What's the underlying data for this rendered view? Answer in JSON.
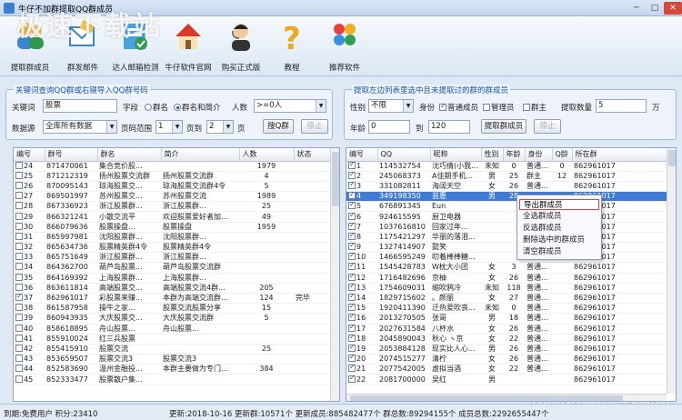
{
  "window": {
    "title": "牛仔不加群提取QQ群成员",
    "min": "─",
    "max": "□",
    "close": "✕"
  },
  "toolbar": [
    {
      "label": "提取群成员",
      "icon": "people-icon"
    },
    {
      "label": "群发邮件",
      "icon": "mail-icon"
    },
    {
      "label": "达人邮箱检测",
      "icon": "mail-check-icon"
    },
    {
      "label": "牛仔软件官网",
      "icon": "home-icon"
    },
    {
      "label": "购买正式版",
      "icon": "support-icon"
    },
    {
      "label": "教程",
      "icon": "help-icon"
    },
    {
      "label": "推荐软件",
      "icon": "apps-icon"
    }
  ],
  "watermark": "极速下载站",
  "left": {
    "panel_title": "关键词查询QQ群或右键导入QQ群号码",
    "keyword_label": "关键词",
    "keyword_value": "股票",
    "field_label": "字段",
    "field_options": [
      "群名",
      "群名和简介"
    ],
    "field_selected": "群名和简介",
    "people_label": "人数",
    "people_value": ">=0人",
    "source_label": "数据源",
    "source_value": "全库所有数据",
    "page_range_label": "页码范围",
    "page_from": "1",
    "page_to_label": "页到",
    "page_to": "2",
    "page_unit": "页",
    "search_btn": "搜Q群",
    "stop_btn": "停止",
    "columns": [
      "编号",
      "群号",
      "群名",
      "简介",
      "人数",
      "状态"
    ],
    "rows": [
      [
        "24",
        "871470061",
        "集合竞价股...",
        "",
        "1979",
        ""
      ],
      [
        "25",
        "871212319",
        "扬州股票交流群",
        "扬州股票交流群",
        "4",
        ""
      ],
      [
        "26",
        "870095143",
        "琼海股票交...",
        "琼海股票交流群4令",
        "5",
        ""
      ],
      [
        "27",
        "869501997",
        "苏州股票交...",
        "苏州股票交流",
        "1989",
        ""
      ],
      [
        "28",
        "867336923",
        "浙江股票群...",
        "浙江股票群...",
        "25",
        ""
      ],
      [
        "29",
        "866321241",
        "小散交流平",
        "欢迎股票爱好者加...",
        "49",
        ""
      ],
      [
        "30",
        "866079636",
        "股票操盘...",
        "股票操盘",
        "1959",
        ""
      ],
      [
        "31",
        "865997981",
        "沈阳股票群...",
        "沈阳股票群...",
        "",
        ""
      ],
      [
        "32",
        "865634736",
        "股票精英群4令",
        "股票精英群4令",
        "",
        ""
      ],
      [
        "33",
        "865751649",
        "浙江股票群...",
        "浙江股票群...",
        "",
        ""
      ],
      [
        "34",
        "864362700",
        "葫芦岛股票...",
        "葫芦岛股票交流群",
        "",
        ""
      ],
      [
        "35",
        "864169392",
        "上海股票群...",
        "上海股票群...",
        "",
        ""
      ],
      [
        "36",
        "863611814",
        "高端股票交...",
        "高端股票交流4群...",
        "205",
        ""
      ],
      [
        "37",
        "862961017",
        "彩股票来赚...",
        "本群为高端交流群...",
        "124",
        "完毕"
      ],
      [
        "38",
        "861587958",
        "操牛之家...",
        "股票交流股票分享",
        "15",
        ""
      ],
      [
        "39",
        "860943935",
        "大庆股票交...",
        "大庆股票交流群",
        "5",
        ""
      ],
      [
        "40",
        "858618895",
        "舟山股票...",
        "舟山股票...",
        "",
        ""
      ],
      [
        "41",
        "855910024",
        "红三兵股票",
        "",
        "",
        ""
      ],
      [
        "42",
        "855415910",
        "股票交流",
        "",
        "25",
        ""
      ],
      [
        "43",
        "853659507",
        "股票交流3",
        "股票交流3",
        "",
        ""
      ],
      [
        "44",
        "852583690",
        "温州金融投...",
        "本群主要做为专门...",
        "384",
        ""
      ],
      [
        "45",
        "852333477",
        "股票散户集...",
        "",
        "",
        ""
      ]
    ]
  },
  "right": {
    "panel_title": "提取左边列表里选中且未提取过的群的群成员",
    "gender_label": "性别",
    "gender_value": "不限",
    "identity_label": "身份",
    "opt_normal": "普通成员",
    "opt_admin": "管理员",
    "opt_owner": "群主",
    "count_label": "提取数量",
    "count_value": "5",
    "count_unit": "万",
    "age_label": "年龄",
    "age_from": "0",
    "age_to_label": "到",
    "age_to": "120",
    "extract_btn": "提取群成员",
    "stop_btn": "停止",
    "columns": [
      "编号",
      "QQ",
      "昵称",
      "性别",
      "年龄",
      "身份",
      "Q龄",
      "所在群"
    ],
    "rows": [
      [
        "1",
        "114532754",
        "沈巧倩(小我...",
        "未知",
        "0",
        "普通...",
        "0",
        "862961017"
      ],
      [
        "2",
        "245068373",
        "A佳期手机...",
        "男",
        "25",
        "群主",
        "12",
        "862961017"
      ],
      [
        "3",
        "331082811",
        "海阔天空",
        "女",
        "26",
        "普通...",
        "",
        "862961017"
      ],
      [
        "4",
        "349198350",
        "芸惠",
        "男",
        "28",
        "",
        "",
        "862961017"
      ],
      [
        "5",
        "676891345",
        "Eun",
        "",
        "",
        "",
        "",
        "862961017"
      ],
      [
        "6",
        "924615595",
        "厨卫电器",
        "",
        "",
        "",
        "",
        "862961017"
      ],
      [
        "7",
        "1037616810",
        "回家过年...",
        "",
        "",
        "",
        "",
        "862961017"
      ],
      [
        "8",
        "1175421297",
        "华丽的落泪...",
        "",
        "",
        "",
        "",
        "862961017"
      ],
      [
        "9",
        "1327414907",
        "懿笑",
        "",
        "",
        "",
        "",
        "862961017"
      ],
      [
        "10",
        "1466595249",
        "叨着棒棒糖...",
        "",
        "",
        "",
        "",
        "862961017"
      ],
      [
        "11",
        "1545428783",
        "W枕大小团",
        "女",
        "3",
        "普通...",
        "",
        "862961017"
      ],
      [
        "12",
        "1716482696",
        "京柚",
        "女",
        "26",
        "普通...",
        "",
        "862961017"
      ],
      [
        "13",
        "1754609031",
        "缩吹鸦冷",
        "未知",
        "118",
        "普通...",
        "",
        "862961017"
      ],
      [
        "14",
        "1829715602",
        "。颜丽",
        "女",
        "27",
        "普通...",
        "",
        "862961017"
      ],
      [
        "15",
        "1920411390",
        "迁热爱吹丧...",
        "未知",
        "0",
        "普通...",
        "",
        "862961017"
      ],
      [
        "16",
        "2013270505",
        "张哥",
        "男",
        "18",
        "普通...",
        "",
        "862961017"
      ],
      [
        "17",
        "2027631584",
        "八杯水",
        "女",
        "26",
        "普通...",
        "",
        "862961017"
      ],
      [
        "18",
        "2045890043",
        "秋心 ヽ京",
        "女",
        "22",
        "普通...",
        "",
        "862961017"
      ],
      [
        "19",
        "2053884128",
        "现实比人心...",
        "男",
        "26",
        "普通...",
        "",
        "862961017"
      ],
      [
        "20",
        "2074515277",
        "清柠",
        "女",
        "26",
        "普通...",
        "",
        "862961017"
      ],
      [
        "21",
        "2077542005",
        "虚拟当酒",
        "女",
        "22",
        "普通...",
        "",
        "862961017"
      ],
      [
        "22",
        "2081700000",
        "吴红",
        "男",
        "",
        "",
        "",
        "862961017"
      ]
    ],
    "selected_row": 3,
    "context_menu": [
      "导出群成员",
      "全选群成员",
      "反选群成员",
      "删除选中的群成员",
      "清空群成员"
    ]
  },
  "status": {
    "user": "到期:免费用户 积分:23410",
    "update": "更新:2018-10-16 更新群:10571个 更新成员:885482477个 群总数:89294155个 成员总数:2292655447个"
  }
}
